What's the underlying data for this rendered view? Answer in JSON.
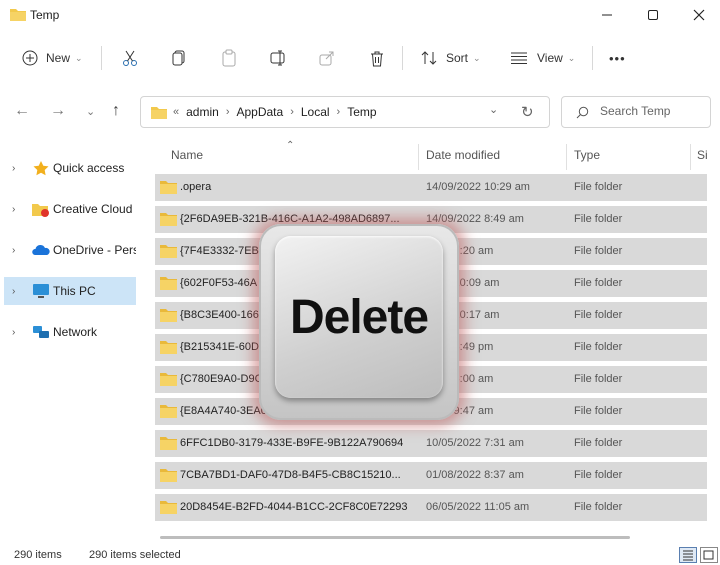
{
  "window": {
    "title": "Temp"
  },
  "toolbar": {
    "new_label": "New",
    "sort_label": "Sort",
    "view_label": "View",
    "more_label": "•••"
  },
  "address": {
    "crumbs": [
      "admin",
      "AppData",
      "Local",
      "Temp"
    ],
    "overflow": "«"
  },
  "search": {
    "placeholder": "Search Temp"
  },
  "sidebar": {
    "items": [
      {
        "label": "Quick access",
        "icon": "star-icon"
      },
      {
        "label": "Creative Cloud",
        "icon": "creative-cloud-icon"
      },
      {
        "label": "OneDrive - Pers",
        "icon": "onedrive-cloud-icon"
      },
      {
        "label": "This PC",
        "icon": "monitor-icon",
        "selected": true
      },
      {
        "label": "Network",
        "icon": "network-icon"
      }
    ]
  },
  "columns": {
    "name": "Name",
    "date": "Date modified",
    "type": "Type",
    "size": "Si"
  },
  "files": [
    {
      "name": ".opera",
      "date": "14/09/2022 10:29 am",
      "type": "File folder"
    },
    {
      "name": "{2F6DA9EB-321B-416C-A1A2-498AD6897...",
      "date": "14/09/2022 8:49 am",
      "type": "File folder"
    },
    {
      "name": "{7F4E3332-7EBF",
      "date": "2022 7:20 am",
      "type": "File folder"
    },
    {
      "name": "{602F0F53-46A",
      "date": "2022 10:09 am",
      "type": "File folder"
    },
    {
      "name": "{B8C3E400-166",
      "date": "2022 10:17 am",
      "type": "File folder"
    },
    {
      "name": "{B215341E-60D",
      "date": "2022 3:49 pm",
      "type": "File folder"
    },
    {
      "name": "{C780E9A0-D9C",
      "date": "2022 8:00 am",
      "type": "File folder"
    },
    {
      "name": "{E8A4A740-3EA0",
      "date": "2022 9:47 am",
      "type": "File folder"
    },
    {
      "name": "6FFC1DB0-3179-433E-B9FE-9B122A790694",
      "date": "10/05/2022 7:31 am",
      "type": "File folder"
    },
    {
      "name": "7CBA7BD1-DAF0-47D8-B4F5-CB8C15210...",
      "date": "01/08/2022 8:37 am",
      "type": "File folder"
    },
    {
      "name": "20D8454E-B2FD-4044-B1CC-2CF8C0E72293",
      "date": "06/05/2022 11:05 am",
      "type": "File folder"
    }
  ],
  "status": {
    "count": "290 items",
    "selected": "290 items selected"
  },
  "overlay": {
    "key_label": "Delete"
  },
  "colors": {
    "selection": "#d9d9d9",
    "nav_selected": "#cce4f7",
    "folder": "#f2c94c",
    "key_glow": "#c0605f"
  }
}
